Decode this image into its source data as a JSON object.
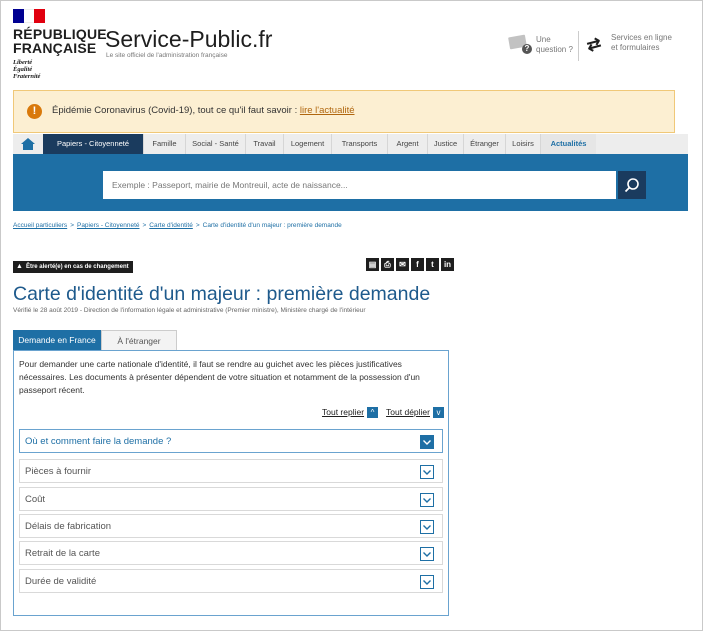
{
  "header": {
    "republique_line1": "RÉPUBLIQUE",
    "republique_line2": "FRANÇAISE",
    "motto_1": "Liberté",
    "motto_2": "Égalité",
    "motto_3": "Fraternité",
    "site_title": "Service-Public.fr",
    "site_subtitle": "Le site officiel de l'administration française",
    "question_l1": "Une",
    "question_l2": "question ?",
    "services_l1": "Services en ligne",
    "services_l2": "et formulaires"
  },
  "alert": {
    "text": "Épidémie Coronavirus (Covid-19), tout ce qu'il faut savoir : ",
    "link": "lire l'actualité"
  },
  "nav": {
    "items": [
      "Papiers - Citoyenneté",
      "Famille",
      "Social - Santé",
      "Travail",
      "Logement",
      "Transports",
      "Argent",
      "Justice",
      "Étranger",
      "Loisirs",
      "Actualités"
    ]
  },
  "search": {
    "placeholder": "Exemple : Passeport, mairie de Montreuil, acte de naissance..."
  },
  "breadcrumb": {
    "items": [
      "Accueil particuliers",
      "Papiers - Citoyenneté",
      "Carte d'identité"
    ],
    "current": "Carte d'identité d'un majeur : première demande"
  },
  "alert_me": "Être alerté(e) en cas de changement",
  "page_title": "Carte d'identité d'un majeur : première demande",
  "verified": "Vérifié le 28 août 2019 - Direction de l'information légale et administrative (Premier ministre), Ministère chargé de l'intérieur",
  "tabs": [
    "Demande en France",
    "À l'étranger"
  ],
  "intro": "Pour demander une carte nationale d'identité, il faut se rendre au guichet avec les pièces justificatives nécessaires. Les documents à présenter dépendent de votre situation et notamment de la possession d'un passeport récent.",
  "controls": {
    "collapse_all": "Tout replier",
    "expand_all": "Tout déplier"
  },
  "accordion": [
    "Où et comment faire la demande ?",
    "Pièces à fournir",
    "Coût",
    "Délais de fabrication",
    "Retrait de la carte",
    "Durée de validité"
  ]
}
